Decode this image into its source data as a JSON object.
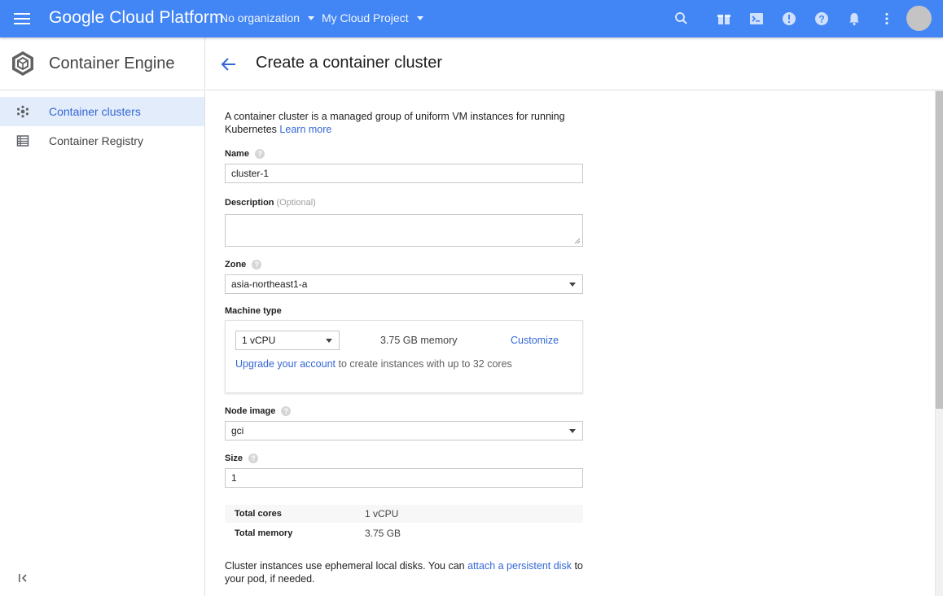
{
  "topbar": {
    "brand": "Google Cloud Platform",
    "organization": "No organization",
    "project": "My Cloud Project",
    "accent": "#4285f4"
  },
  "sidebar": {
    "title": "Container Engine",
    "items": [
      {
        "label": "Container clusters",
        "icon": "clusters-icon",
        "active": true
      },
      {
        "label": "Container Registry",
        "icon": "registry-icon",
        "active": false
      }
    ]
  },
  "main": {
    "title": "Create a container cluster",
    "intro_text": "A container cluster is a managed group of uniform VM instances for running Kubernetes",
    "intro_link": "Learn more",
    "fields": {
      "name_label": "Name",
      "name_value": "cluster-1",
      "description_label": "Description",
      "description_optional": "(Optional)",
      "description_value": "",
      "zone_label": "Zone",
      "zone_value": "asia-northeast1-a",
      "machine_label": "Machine type",
      "machine_vcpu": "1 vCPU",
      "machine_memory": "3.75 GB memory",
      "customize": "Customize",
      "upgrade_link": "Upgrade your account",
      "upgrade_rest": "to create instances with up to 32 cores",
      "node_image_label": "Node image",
      "node_image_value": "gci",
      "size_label": "Size",
      "size_value": "1"
    },
    "summary": [
      {
        "key": "Total cores",
        "value": "1 vCPU"
      },
      {
        "key": "Total memory",
        "value": "3.75 GB"
      }
    ],
    "footnote_pre": "Cluster instances use ephemeral local disks. You can",
    "footnote_link": "attach a persistent disk",
    "footnote_post": "to your pod, if needed."
  }
}
